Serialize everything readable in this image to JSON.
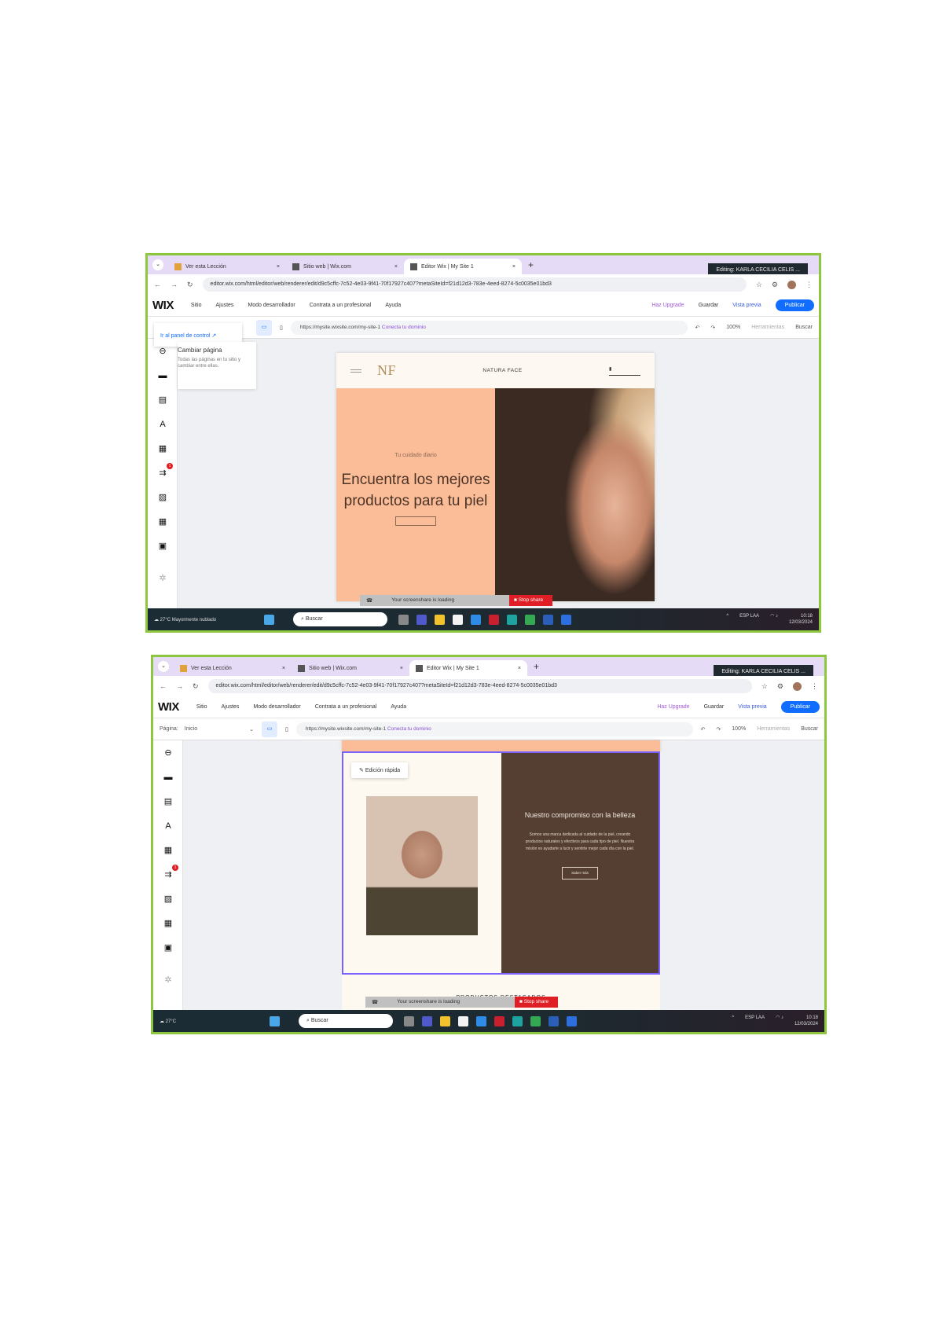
{
  "shots": [
    {
      "tabs": [
        "Ver esta Lección",
        "Sitio web | Wix.com",
        "Editor Wix | My Site 1"
      ],
      "tooltip": "Editing: KARLA CECILIA CELIS ...",
      "url": "editor.wix.com/html/editor/web/renderer/edit/d9c5cffc-7c52-4e03-9f41-70f17927c407?metaSiteId=f21d12d3-783e-4eed-8274-5c0035e01bd3",
      "left_tool": "Ir al panel de control",
      "panel_title": "Cambiar página",
      "panel_text": "Todas las páginas en tu sitio y cambiar entre ellas.",
      "hero_kicker": "Tu cuidado diario",
      "hero_title": "Encuentra los mejores productos para tu piel",
      "brand": "NATURA FACE",
      "logo": "NF"
    },
    {
      "tabs": [
        "Ver esta Lección",
        "Sitio web | Wix.com",
        "Editor Wix | My Site 1"
      ],
      "tooltip": "Editing: KARLA CECILIA CELIS ...",
      "url": "editor.wix.com/html/editor/web/renderer/edit/d9c5cffc-7c52-4e03-9f41-70f17927c407?metaSiteId=f21d12d3-783e-4eed-8274-5c0035e01bd3",
      "page_label": "Página:",
      "page_value": "Inicio",
      "quick_edit": "Edición rápida",
      "section_title": "Nuestro compromiso con la belleza",
      "section_text": "Somos una marca dedicada al cuidado de la piel, creando productos naturales y efectivos para cada tipo de piel. Nuestra misión es ayudarte a lucir y sentirte mejor cada día con la piel.",
      "section_button": "Saber más",
      "next_heading": "PRODUCTOS DESTACADOS"
    }
  ],
  "menu": [
    "Sitio",
    "Ajustes",
    "Modo desarrollador",
    "Contrata a un profesional",
    "Ayuda"
  ],
  "actions": {
    "upgrade": "Haz Upgrade",
    "save": "Guardar",
    "preview": "Vista previa",
    "publish": "Publicar"
  },
  "site_url": "https://mysite.wixsite.com/my-site-1",
  "connect_domain": "Conecta tu dominio",
  "zoom": "100%",
  "tools": "Herramientas",
  "search": "Buscar",
  "loading": "Your screenshare is loading",
  "stop_share": "Stop share",
  "taskbar": {
    "weather_temp": "27°C",
    "weather_desc": "Mayormente nublado",
    "search": "Buscar",
    "lang": "ESP LAA",
    "time": "10:18",
    "date": "12/03/2024"
  },
  "colors": {
    "accent": "#116dff",
    "peach": "#fbbd98",
    "brown": "#553f33",
    "frame": "#8dc63f"
  }
}
